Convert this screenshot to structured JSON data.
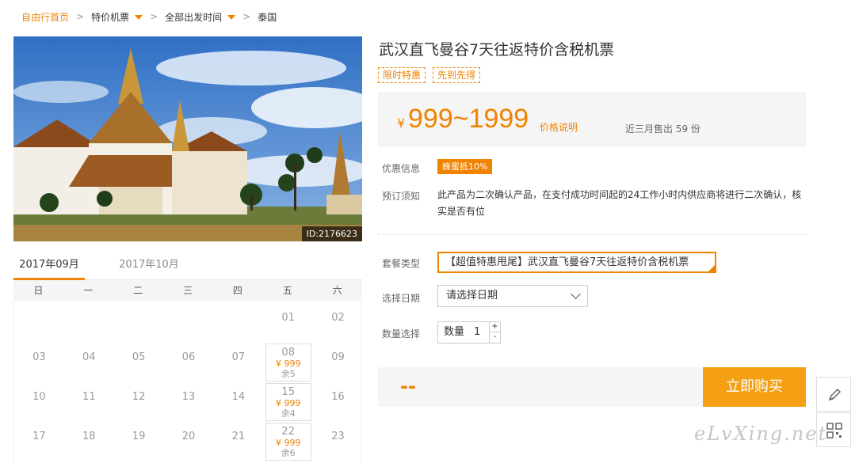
{
  "breadcrumb": {
    "home": "自由行首页",
    "items": [
      "特价机票",
      "全部出发时间",
      "泰国"
    ],
    "sep": ">"
  },
  "photo": {
    "id_label": "ID:2176623"
  },
  "calendar": {
    "tabs": [
      "2017年09月",
      "2017年10月"
    ],
    "weekdays": [
      "日",
      "一",
      "二",
      "三",
      "四",
      "五",
      "六"
    ],
    "rows": [
      [
        "",
        "",
        "",
        "",
        "",
        "01",
        "02"
      ],
      [
        "03",
        "04",
        "05",
        "06",
        "07",
        "08",
        "09"
      ],
      [
        "10",
        "11",
        "12",
        "13",
        "14",
        "15",
        "16"
      ],
      [
        "17",
        "18",
        "19",
        "20",
        "21",
        "22",
        "23"
      ]
    ],
    "available": [
      {
        "day": "08",
        "price": "¥ 999",
        "stock": "余5"
      },
      {
        "day": "15",
        "price": "¥ 999",
        "stock": "余4"
      },
      {
        "day": "22",
        "price": "¥ 999",
        "stock": "余6"
      }
    ]
  },
  "product": {
    "title": "武汉直飞曼谷7天往返特价含税机票",
    "tags": [
      "限时特惠",
      "先到先得"
    ],
    "price_symbol": "¥",
    "price_range": "999~1999",
    "price_note": "价格说明",
    "sold": "近三月售出 59 份"
  },
  "info": {
    "promo_label": "优惠信息",
    "promo_badge": "蜂蜜抵10%",
    "notice_label": "预订须知",
    "notice_text": "此产品为二次确认产品，在支付成功时间起的24工作小时内供应商将进行二次确认，核实是否有位"
  },
  "options": {
    "package_label": "套餐类型",
    "package_value": "【超值特惠甩尾】武汉直飞曼谷7天往返特价含税机票",
    "date_label": "选择日期",
    "date_value": "请选择日期",
    "qty_label": "数量选择",
    "qty_prefix": "数量",
    "qty_value": "1",
    "qty_up": "+",
    "qty_down": "-"
  },
  "buy": {
    "total": "--",
    "button": "立即购买"
  },
  "watermark": "eLvXing.net",
  "colors": {
    "accent": "#f08300",
    "button": "#f5a012"
  }
}
